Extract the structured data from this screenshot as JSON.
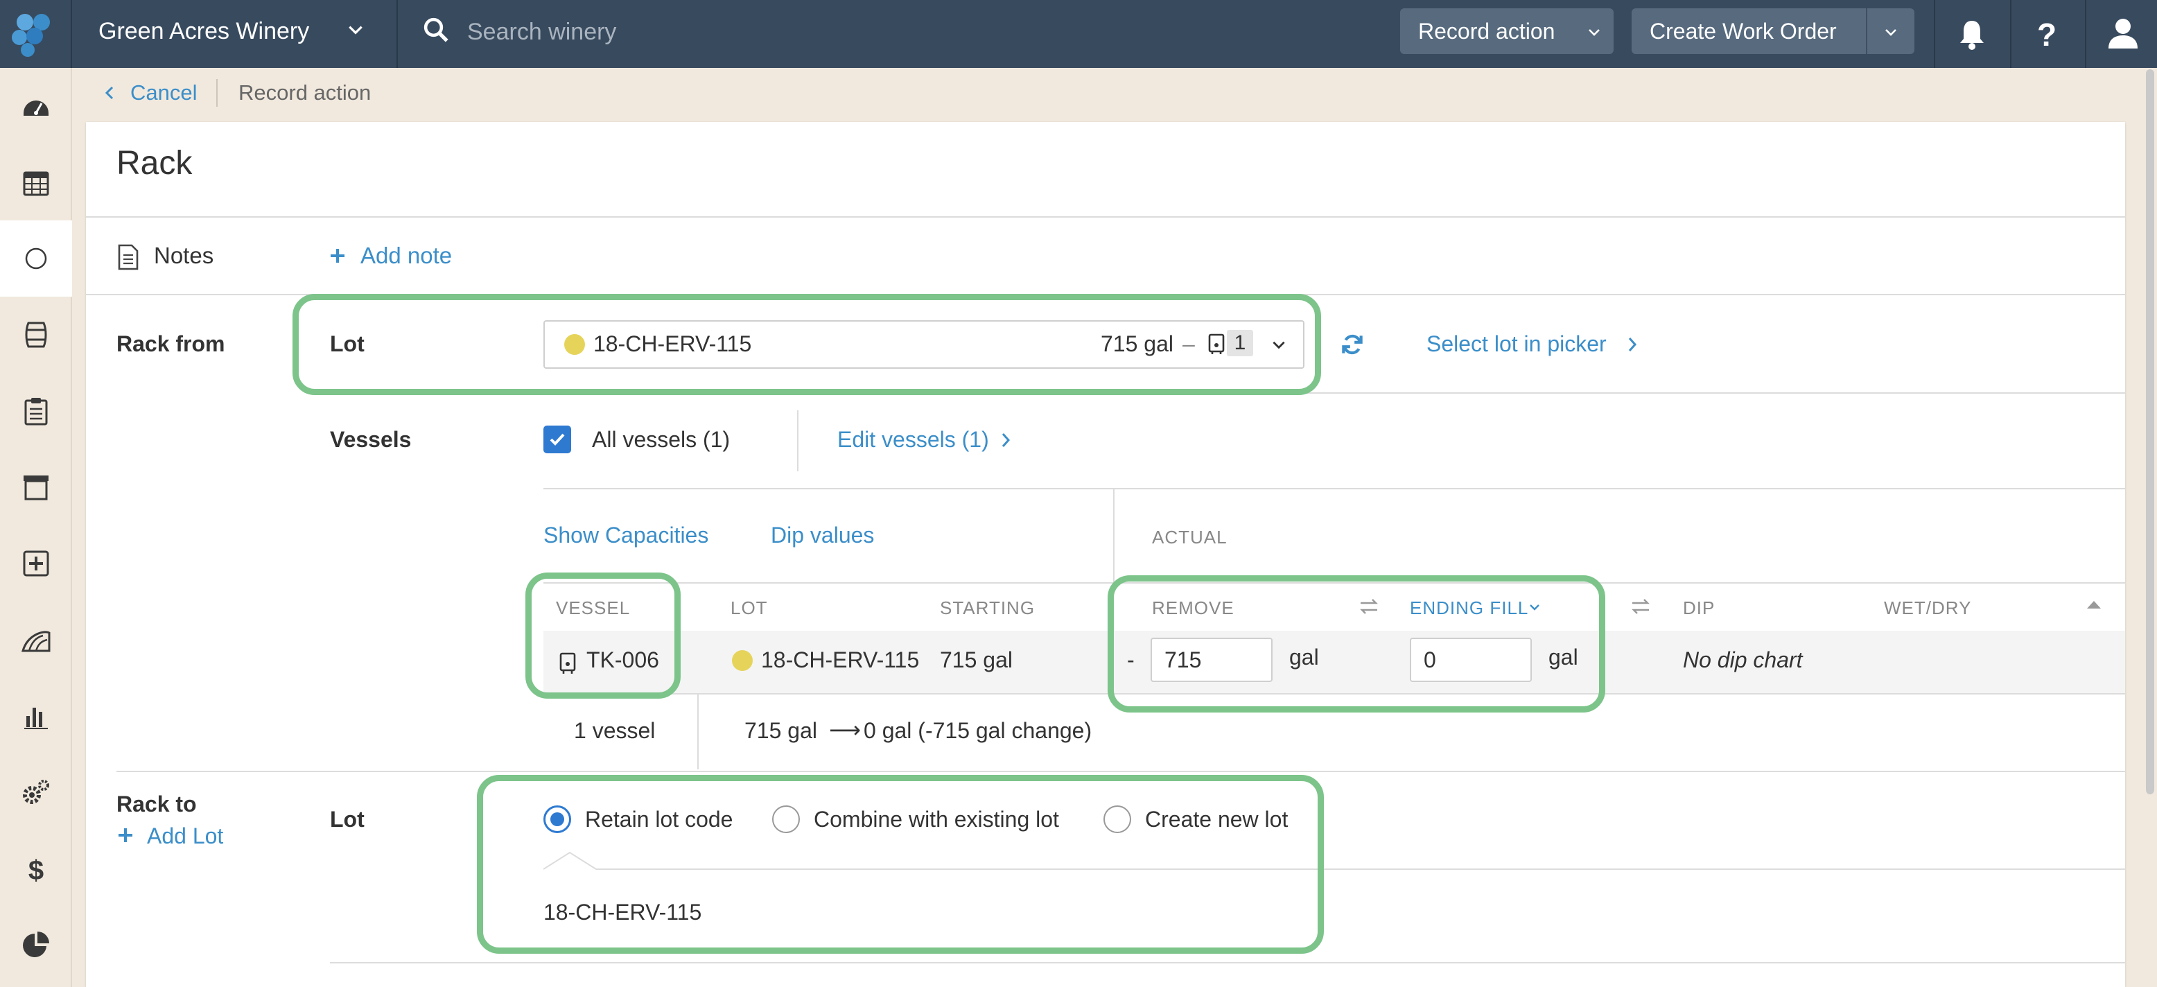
{
  "topbar": {
    "winery_name": "Green Acres Winery",
    "search_placeholder": "Search winery",
    "record_action_label": "Record action",
    "create_work_order_label": "Create Work Order",
    "bg_color": "#384a5e",
    "button_color": "#576a7e"
  },
  "sidebar": {
    "items": [
      {
        "icon": "dashboard-icon"
      },
      {
        "icon": "calendar-icon"
      },
      {
        "icon": "circle-icon",
        "active": true
      },
      {
        "icon": "barrel-icon"
      },
      {
        "icon": "clipboard-icon"
      },
      {
        "icon": "archive-icon"
      },
      {
        "icon": "plus-square-icon"
      },
      {
        "icon": "vineyard-icon"
      },
      {
        "icon": "bar-chart-icon"
      },
      {
        "icon": "gears-icon"
      },
      {
        "icon": "dollar-icon"
      },
      {
        "icon": "pie-chart-icon"
      }
    ]
  },
  "breadcrumb": {
    "cancel_label": "Cancel",
    "current_label": "Record action"
  },
  "page": {
    "title": "Rack"
  },
  "notes": {
    "label": "Notes",
    "add_note_label": "Add note"
  },
  "rack_from": {
    "section_label": "Rack from",
    "lot_label": "Lot",
    "lot_code": "18-CH-ERV-115",
    "lot_volume": "715 gal",
    "lot_dash": "–",
    "vessel_count_badge": "1",
    "select_lot_link": "Select lot in picker",
    "vessels_label": "Vessels",
    "all_vessels_label": "All vessels (1)",
    "all_vessels_checked": true,
    "edit_vessels_link": "Edit vessels (1)",
    "show_capacities_link": "Show Capacities",
    "dip_values_link": "Dip values",
    "actual_label": "ACTUAL",
    "table": {
      "headers": {
        "vessel": "VESSEL",
        "lot": "LOT",
        "starting": "STARTING",
        "remove": "REMOVE",
        "ending_fill": "ENDING FILL",
        "dip": "DIP",
        "wet_dry": "WET/DRY"
      },
      "rows": [
        {
          "vessel": "TK-006",
          "lot": "18-CH-ERV-115",
          "starting": "715 gal",
          "remove_prefix": "-",
          "remove_value": "715",
          "remove_unit": "gal",
          "ending_value": "0",
          "ending_unit": "gal",
          "dip": "No dip chart"
        }
      ],
      "footer_count": "1 vessel",
      "footer_from": "715 gal",
      "footer_arrow": "⟶",
      "footer_to": "0 gal (-715 gal change)"
    }
  },
  "rack_to": {
    "section_label": "Rack to",
    "add_lot_label": "Add Lot",
    "lot_label": "Lot",
    "options": [
      "Retain lot code",
      "Combine with existing lot",
      "Create new lot"
    ],
    "selected_option": "Retain lot code",
    "lot_code": "18-CH-ERV-115"
  },
  "colors": {
    "link": "#3b8ec9",
    "highlight": "#7cc48a",
    "lot_dot": "#e6d45a",
    "accent": "#2e7ad1"
  }
}
